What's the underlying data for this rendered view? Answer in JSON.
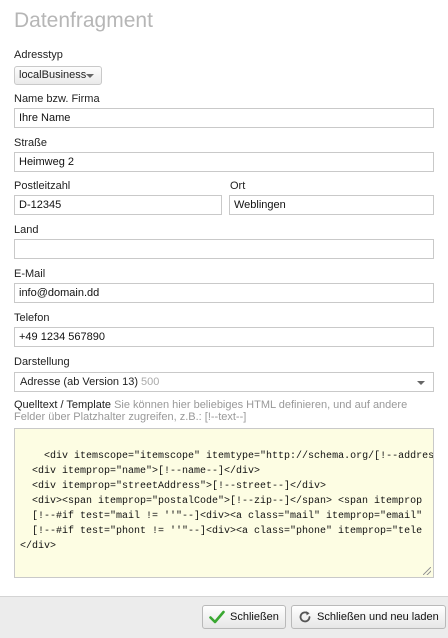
{
  "dialog": {
    "title": "Datenfragment"
  },
  "adresstyp": {
    "label": "Adresstyp",
    "value": "localBusiness"
  },
  "name": {
    "label": "Name bzw. Firma",
    "value": "Ihre Name"
  },
  "strasse": {
    "label": "Straße",
    "value": "Heimweg 2"
  },
  "plz": {
    "label": "Postleitzahl",
    "value": "D-12345"
  },
  "ort": {
    "label": "Ort",
    "value": "Weblingen"
  },
  "land": {
    "label": "Land",
    "value": ""
  },
  "email": {
    "label": "E-Mail",
    "value": "info@domain.dd"
  },
  "telefon": {
    "label": "Telefon",
    "value": "+49 1234 567890"
  },
  "darstellung": {
    "label": "Darstellung",
    "value": "Adresse (ab Version 13)",
    "badge": "500"
  },
  "quelltext": {
    "label": "Quelltext / Template",
    "hint": "Sie können hier beliebiges HTML definieren, und auf andere Felder über Platzhalter zugreifen, z.B.: [!--text--]",
    "code": "<div itemscope=\"itemscope\" itemtype=\"http://schema.org/[!--addresst\n  <div itemprop=\"name\">[!--name--]</div>\n  <div itemprop=\"streetAddress\">[!--street--]</div>\n  <div><span itemprop=\"postalCode\">[!--zip--]</span> <span itemprop\n  [!--#if test=\"mail != ''\"--]<div><a class=\"mail\" itemprop=\"email\"\n  [!--#if test=\"phont != ''\"--]<div><a class=\"phone\" itemprop=\"tele\n</div>"
  },
  "buttons": {
    "close": "Schließen",
    "close_new": "Schließen und neu laden"
  },
  "colors": {
    "code_background": "#fdfde3",
    "check_green": "#3aa832",
    "title_gray": "#b6b6b6"
  }
}
